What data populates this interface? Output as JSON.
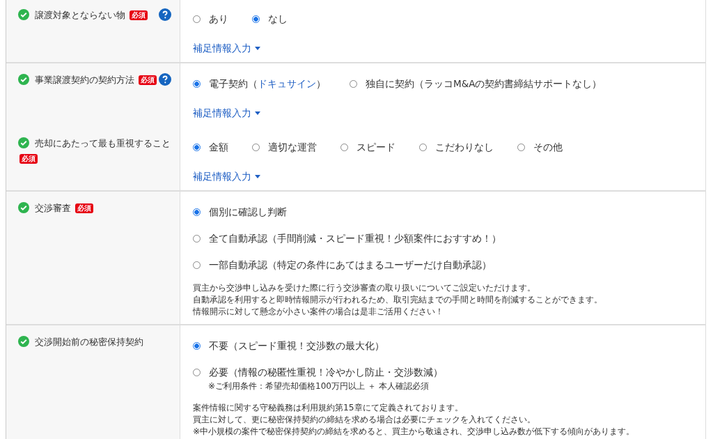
{
  "sections": [
    {
      "items": [
        {
          "label": "譲渡対象とならない物",
          "required_badge": "必須",
          "help": true,
          "checked": true,
          "kind": "inline",
          "options": [
            {
              "label": "あり",
              "selected": false
            },
            {
              "label": "なし",
              "selected": true
            }
          ],
          "supplement_link": "補足情報入力"
        }
      ]
    },
    {
      "items": [
        {
          "label": "事業譲渡契約の契約方法",
          "required_badge": "必須",
          "help": true,
          "checked": true,
          "kind": "inline",
          "options": [
            {
              "label": "電子契約（",
              "link": "ドキュサイン",
              "suffix": "）",
              "selected": true
            },
            {
              "label": "独自に契約（ラッコM&Aの契約書締結サポートなし）",
              "selected": false
            }
          ],
          "supplement_link": "補足情報入力"
        },
        {
          "label": "売却にあたって最も重視すること",
          "required_badge": "必須",
          "checked": true,
          "kind": "inline",
          "options": [
            {
              "label": "金額",
              "selected": true
            },
            {
              "label": "適切な運営",
              "selected": false
            },
            {
              "label": "スピード",
              "selected": false
            },
            {
              "label": "こだわりなし",
              "selected": false
            },
            {
              "label": "その他",
              "selected": false
            }
          ],
          "supplement_link": "補足情報入力"
        }
      ]
    },
    {
      "items": [
        {
          "label": "交渉審査",
          "required_badge": "必須",
          "checked": true,
          "kind": "stacked",
          "options": [
            {
              "label": "個別に確認し判断",
              "selected": true
            },
            {
              "label": "全て自動承認（手間削減・スピード重視！少額案件におすすめ！）",
              "selected": false
            },
            {
              "label": "一部自動承認（特定の条件にあてはまるユーザーだけ自動承認）",
              "selected": false
            }
          ],
          "notes": [
            "買主から交渉申し込みを受けた際に行う交渉審査の取り扱いについてご設定いただけます。",
            "自動承認を利用すると即時情報開示が行われるため、取引完結までの手間と時間を削減することができます。",
            "情報開示に対して懸念が小さい案件の場合は是非ご活用ください！"
          ]
        }
      ]
    },
    {
      "items": [
        {
          "label": "交渉開始前の秘密保持契約",
          "checked": true,
          "kind": "stacked",
          "options": [
            {
              "label": "不要（スピード重視！交渉数の最大化）",
              "selected": true
            },
            {
              "label": "必要（情報の秘匿性重視！冷やかし防止・交渉数減）",
              "selected": false,
              "note": "※ご利用条件：希望売却価格100万円以上 ＋ 本人確認必須"
            }
          ],
          "notes": [
            "案件情報に関する守秘義務は利用規約第15章にて定義されております。",
            "買主に対して、更に秘密保持契約の締結を求める場合は必要にチェックを入れてください。",
            "※中小規模の案件で秘密保持契約の締結を求めると、買主から敬遠され、交渉申し込み数が低下する傾向があります。"
          ]
        }
      ]
    }
  ]
}
